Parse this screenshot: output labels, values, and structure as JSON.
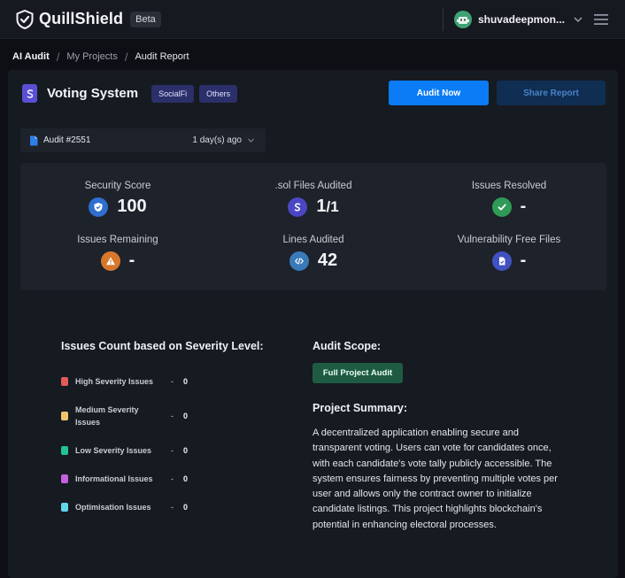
{
  "app": {
    "name": "QuillShield",
    "badge": "Beta",
    "username": "shuvadeepmon..."
  },
  "breadcrumb": [
    "AI Audit",
    "My Projects",
    "Audit Report"
  ],
  "project": {
    "title": "Voting System",
    "tags": [
      "SocialFi",
      "Others"
    ],
    "audit_now_label": "Audit Now",
    "share_report_label": "Share Report",
    "audit_id": "Audit #2551",
    "audit_time": "1 day(s) ago"
  },
  "stats": [
    {
      "label": "Security Score",
      "value": "100",
      "icon": "shield-icon",
      "color": "#2f6fd0"
    },
    {
      "label": ".sol Files Audited",
      "value": "1",
      "value_sub": "/1",
      "icon": "sol-file-icon",
      "color": "#4b47c4"
    },
    {
      "label": "Issues Resolved",
      "value": "-",
      "icon": "check-icon",
      "color": "#2f9b57"
    },
    {
      "label": "Issues Remaining",
      "value": "-",
      "icon": "warning-icon",
      "color": "#d7772c"
    },
    {
      "label": "Lines Audited",
      "value": "42",
      "icon": "code-icon",
      "color": "#3a7ab8"
    },
    {
      "label": "Vulnerability Free Files",
      "value": "-",
      "icon": "file-check-icon",
      "color": "#4052c2"
    }
  ],
  "severity": {
    "title": "Issues Count based on Severity Level:",
    "items": [
      {
        "name": "High Severity Issues",
        "count": "0",
        "color": "#e25a5a"
      },
      {
        "name": "Medium Severity Issues",
        "count": "0",
        "color": "#f0c36a"
      },
      {
        "name": "Low Severity Issues",
        "count": "0",
        "color": "#22c394"
      },
      {
        "name": "Informational Issues",
        "count": "0",
        "color": "#c55fe0"
      },
      {
        "name": "Optimisation Issues",
        "count": "0",
        "color": "#62d6ea"
      }
    ]
  },
  "scope": {
    "title": "Audit Scope:",
    "badge": "Full Project Audit"
  },
  "summary": {
    "title": "Project Summary:",
    "text": "A decentralized application enabling secure and transparent voting. Users can vote for candidates once, with each candidate's vote tally publicly accessible. The system ensures fairness by preventing multiple votes per user and allows only the contract owner to initialize candidate listings. This project highlights blockchain's potential in enhancing electoral processes."
  }
}
